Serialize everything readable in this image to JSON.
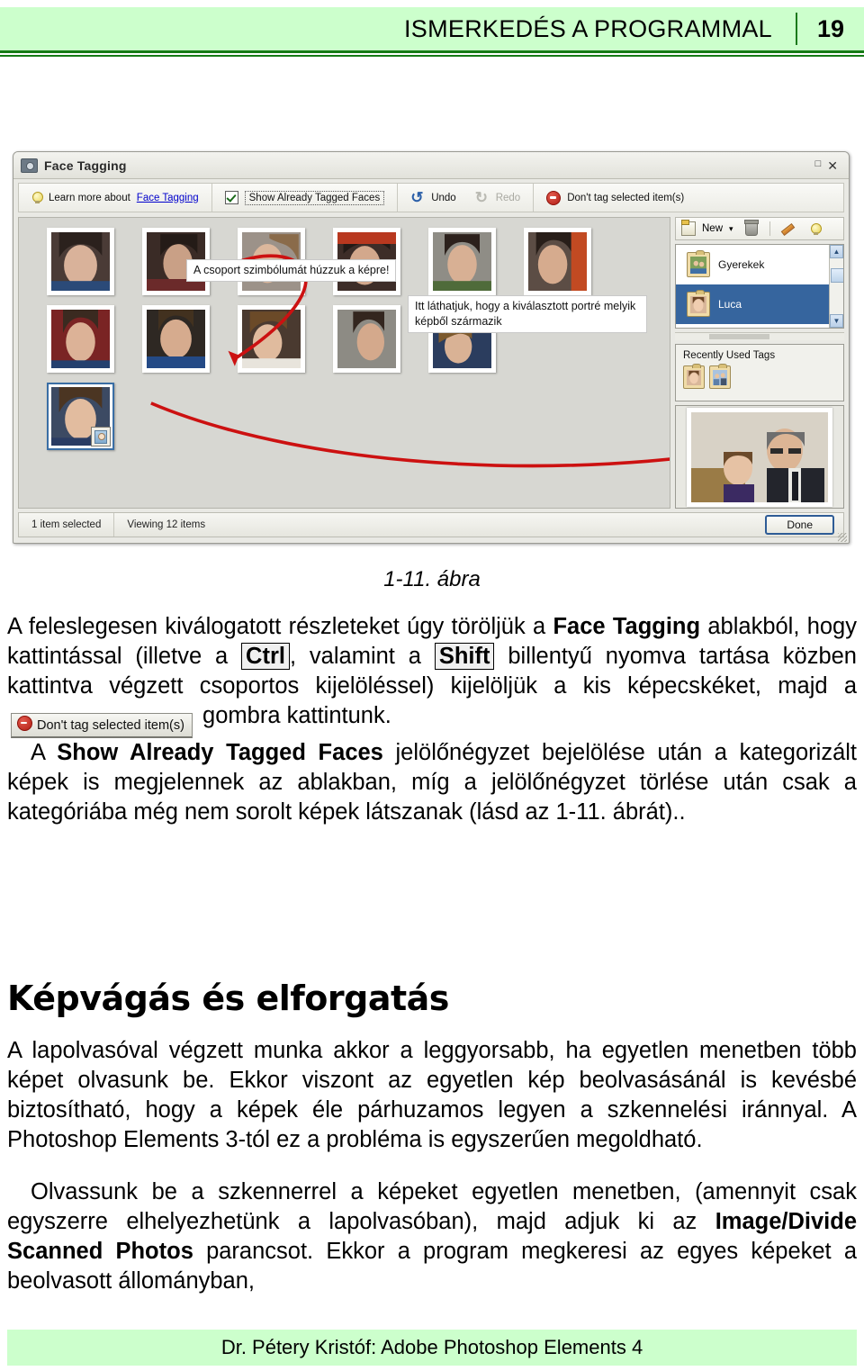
{
  "header": {
    "title": "ISMERKEDÉS A PROGRAMMAL",
    "page_number": "19"
  },
  "figure": {
    "window_title": "Face Tagging",
    "window_icon": "camera-icon",
    "controls": {
      "maximize": "□",
      "close": "✕"
    },
    "toolbar": {
      "learn_more_prefix": "Learn more about ",
      "learn_more_link": "Face Tagging",
      "show_tagged_label": "Show Already Tagged Faces",
      "show_tagged_checked": true,
      "undo_label": "Undo",
      "redo_label": "Redo",
      "dont_tag_label": "Don't tag selected item(s)"
    },
    "tag_panel": {
      "new_label": "New",
      "new_caret": "▾",
      "tags": [
        {
          "label": "Gyerekek",
          "selected": false
        },
        {
          "label": "Luca",
          "selected": true
        }
      ],
      "recent_title": "Recently Used Tags"
    },
    "annotations": [
      "A csoport szimbólumát húzzuk a képre!",
      "Itt láthatjuk, hogy a kiválasztott portré melyik képből származik"
    ],
    "statusbar": {
      "selected": "1 item selected",
      "viewing": "Viewing 12 items",
      "done_label": "Done"
    },
    "thumbnails": {
      "row1_count": 6,
      "row2_count": 5,
      "row3_count": 1,
      "selected_index": 11
    }
  },
  "caption": "1-11. ábra",
  "body": {
    "p1_a": "A feleslegesen kiválogatott részleteket úgy töröljük a ",
    "p1_b": "Face Tagging",
    "p1_c": " ablakból, hogy kattintással (illetve a ",
    "p1_key1": "Ctrl",
    "p1_d": ", valamint a ",
    "p1_key2": "Shift",
    "p1_e": " billentyű nyomva tartása közben kattintva végzett csoportos kijelöléssel) kijelöljük a kis képecskéket, majd a ",
    "p1_btn": "Don't tag selected item(s)",
    "p1_f": " gombra kattintunk.",
    "p2_a": "A ",
    "p2_b": "Show Already Tagged Faces",
    "p2_c": " jelölőnégyzet bejelölése után a kategorizált képek is megjelennek az ablakban, míg a jelölőnégyzet törlése után csak a kategóriába még nem sorolt képek látszanak (lásd az 1-11. ábrát).."
  },
  "section": {
    "heading": "Képvágás és elforgatás",
    "p1": "A lapolvasóval végzett munka akkor a leggyorsabb, ha egyetlen menetben több képet olvasunk be. Ekkor viszont az egyetlen kép beolvasásánál is kevésbé biztosítható, hogy a képek éle párhuzamos legyen a szkennelési iránnyal. A Photoshop Elements 3-tól ez a probléma is egyszerűen megoldható.",
    "p2_a": "Olvassunk be a szkennerrel a képeket egyetlen menetben, (amennyit csak egyszerre elhelyezhetünk a lapolvasóban), majd adjuk ki az ",
    "p2_b": "Image/Divide Scanned Photos",
    "p2_c": " parancsot. Ekkor a program megkeresi az egyes képeket a beolvasott állományban,"
  },
  "footer": {
    "text": "Dr. Pétery Kristóf: Adobe Photoshop Elements 4"
  },
  "colors": {
    "band_green": "#ccffcc",
    "rule_green": "#157a15",
    "selection_blue": "#36659e"
  }
}
